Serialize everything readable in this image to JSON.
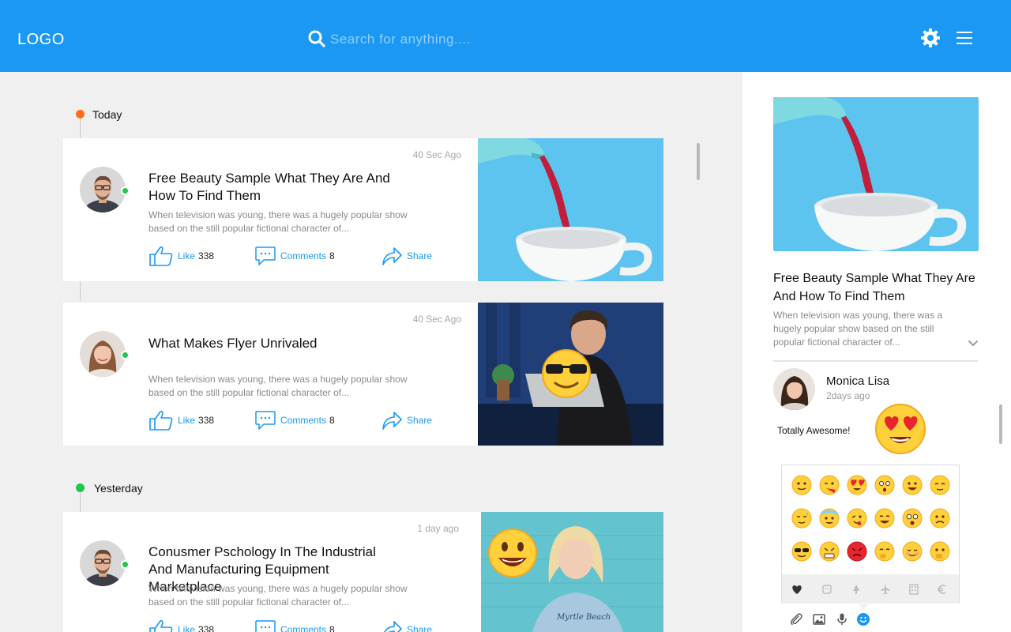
{
  "header": {
    "logo": "LOGO",
    "search_placeholder": "Search for anything....",
    "icons": [
      "search-icon",
      "gear-icon",
      "hamburger-menu-icon"
    ]
  },
  "colors": {
    "brand": "#1a98f4",
    "online": "#1ec84c",
    "today_dot": "#ff6f1a",
    "yesterday_dot": "#1ec84c"
  },
  "feed": {
    "groups": [
      {
        "label": "Today",
        "posts": [
          {
            "time": "40 Sec Ago",
            "title": "Free Beauty Sample What They Are And How To Find Them",
            "desc": "When television was young, there was a hugely popular show based on the still popular fictional character of...",
            "like_label": "Like",
            "likes": "338",
            "comments_label": "Comments",
            "comments": "8",
            "share_label": "Share"
          },
          {
            "time": "40 Sec Ago",
            "title": "What Makes Flyer Unrivaled",
            "desc": "When television was young, there was a hugely popular show based on the still popular fictional character of...",
            "like_label": "Like",
            "likes": "338",
            "comments_label": "Comments",
            "comments": "8",
            "share_label": "Share"
          }
        ]
      },
      {
        "label": "Yesterday",
        "posts": [
          {
            "time": "1 day ago",
            "title": "Conusmer Pschology In The Industrial And Manufacturing Equipment Marketplace",
            "desc": "When television was young, there was a hugely popular show based on the still popular fictional character of...",
            "like_label": "Like",
            "likes": "338",
            "comments_label": "Comments",
            "comments": "8",
            "share_label": "Share"
          }
        ]
      }
    ]
  },
  "sidebar": {
    "title": "Free Beauty Sample What They Are And How To Find Them",
    "desc": "When television was young, there was a hugely popular show based on the still popular fictional character of...",
    "comment": {
      "author": "Monica Lisa",
      "time": "2days ago",
      "text": "Totally Awesome!",
      "reaction": "heart-eyes-emoji"
    },
    "emoji_tabs": [
      "heart-icon",
      "smiley-face-icon",
      "tree-icon",
      "airplane-icon",
      "building-icon",
      "euro-icon"
    ],
    "compose_icons": [
      "paperclip-icon",
      "image-icon",
      "microphone-icon",
      "emoji-icon"
    ]
  }
}
